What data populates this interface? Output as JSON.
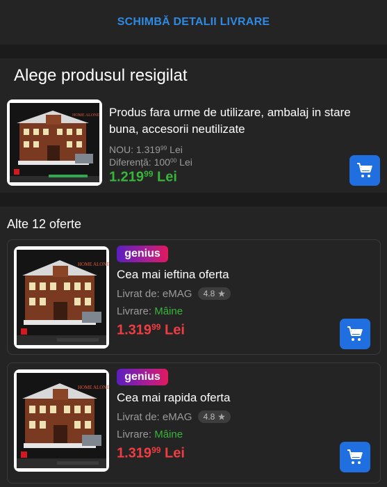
{
  "top": {
    "change_delivery_label": "SCHIMBĂ DETALII LIVRARE"
  },
  "resigilat": {
    "title": "Alege produsul resigilat",
    "description": "Produs fara urme de utilizare, ambalaj in stare buna, accesorii neutilizate",
    "old_price_label": "NOU:",
    "old_price_int": "1.319",
    "old_price_dec": "99",
    "old_price_cur": "Lei",
    "diff_label": "Diferență:",
    "diff_int": "100",
    "diff_dec": "00",
    "diff_cur": "Lei",
    "price_int": "1.219",
    "price_dec": "99",
    "price_cur": "Lei"
  },
  "offers_section": {
    "title": "Alte 12 oferte",
    "offers": [
      {
        "badge": "genius",
        "title": "Cea mai ieftina oferta",
        "seller_label": "Livrat de:",
        "seller": "eMAG",
        "rating": "4.8",
        "delivery_label": "Livrare:",
        "delivery_value": "Mâine",
        "price_int": "1.319",
        "price_dec": "99",
        "price_cur": "Lei"
      },
      {
        "badge": "genius",
        "title": "Cea mai rapida oferta",
        "seller_label": "Livrat de:",
        "seller": "eMAG",
        "rating": "4.8",
        "delivery_label": "Livrare:",
        "delivery_value": "Mâine",
        "price_int": "1.319",
        "price_dec": "99",
        "price_cur": "Lei"
      }
    ]
  },
  "product_box": {
    "brand_logo": "LEGO",
    "product_name": "HOME ALONE"
  },
  "icons": {
    "cart": "shopping-cart-icon",
    "star": "star-icon"
  },
  "colors": {
    "accent_link": "#2f8ae3",
    "price_green": "#38b53a",
    "price_red": "#ef3d43",
    "cart_button": "#1f6fe0"
  }
}
